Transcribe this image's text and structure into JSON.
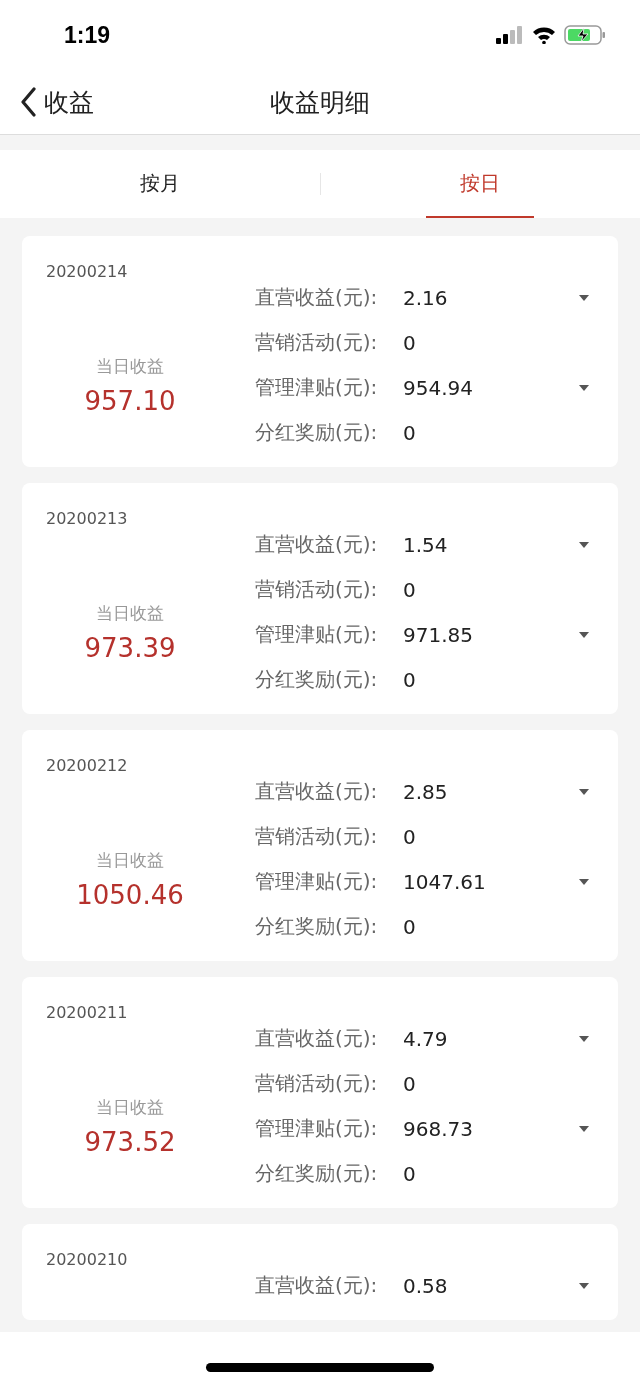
{
  "status_bar": {
    "time": "1:19"
  },
  "nav": {
    "back_label": "收益",
    "title": "收益明细"
  },
  "tabs": [
    {
      "label": "按月",
      "selected": false
    },
    {
      "label": "按日",
      "selected": true
    }
  ],
  "days": [
    {
      "date": "20200214",
      "daily_label": "当日收益",
      "daily_amount": "957.10",
      "rows": [
        {
          "label": "直营收益(元):",
          "value": "2.16",
          "expandable": true
        },
        {
          "label": "营销活动(元):",
          "value": "0",
          "expandable": false
        },
        {
          "label": "管理津贴(元):",
          "value": "954.94",
          "expandable": true
        },
        {
          "label": "分红奖励(元):",
          "value": "0",
          "expandable": false
        }
      ]
    },
    {
      "date": "20200213",
      "daily_label": "当日收益",
      "daily_amount": "973.39",
      "rows": [
        {
          "label": "直营收益(元):",
          "value": "1.54",
          "expandable": true
        },
        {
          "label": "营销活动(元):",
          "value": "0",
          "expandable": false
        },
        {
          "label": "管理津贴(元):",
          "value": "971.85",
          "expandable": true
        },
        {
          "label": "分红奖励(元):",
          "value": "0",
          "expandable": false
        }
      ]
    },
    {
      "date": "20200212",
      "daily_label": "当日收益",
      "daily_amount": "1050.46",
      "rows": [
        {
          "label": "直营收益(元):",
          "value": "2.85",
          "expandable": true
        },
        {
          "label": "营销活动(元):",
          "value": "0",
          "expandable": false
        },
        {
          "label": "管理津贴(元):",
          "value": "1047.61",
          "expandable": true
        },
        {
          "label": "分红奖励(元):",
          "value": "0",
          "expandable": false
        }
      ]
    },
    {
      "date": "20200211",
      "daily_label": "当日收益",
      "daily_amount": "973.52",
      "rows": [
        {
          "label": "直营收益(元):",
          "value": "4.79",
          "expandable": true
        },
        {
          "label": "营销活动(元):",
          "value": "0",
          "expandable": false
        },
        {
          "label": "管理津贴(元):",
          "value": "968.73",
          "expandable": true
        },
        {
          "label": "分红奖励(元):",
          "value": "0",
          "expandable": false
        }
      ]
    },
    {
      "date": "20200210",
      "rows": [
        {
          "label": "直营收益(元):",
          "value": "0.58",
          "expandable": true
        }
      ]
    }
  ]
}
